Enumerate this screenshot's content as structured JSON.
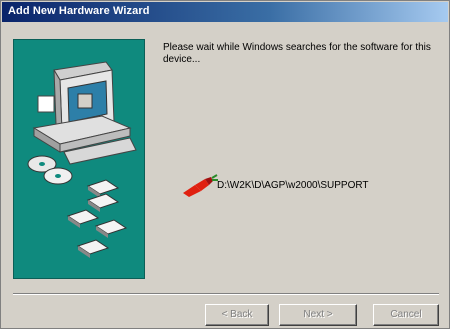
{
  "window": {
    "title": "Add New Hardware Wizard"
  },
  "main": {
    "message": "Please wait while Windows searches for the software for this device...",
    "search_path": "D:\\W2K\\D\\AGP\\w2000\\SUPPORT"
  },
  "buttons": {
    "back": "< Back",
    "next": "Next >",
    "cancel": "Cancel"
  },
  "colors": {
    "titlebar": "#0a246a",
    "panel": "#0f8a7e",
    "dialog": "#d4d0c8",
    "flashlight": "#e02010"
  }
}
